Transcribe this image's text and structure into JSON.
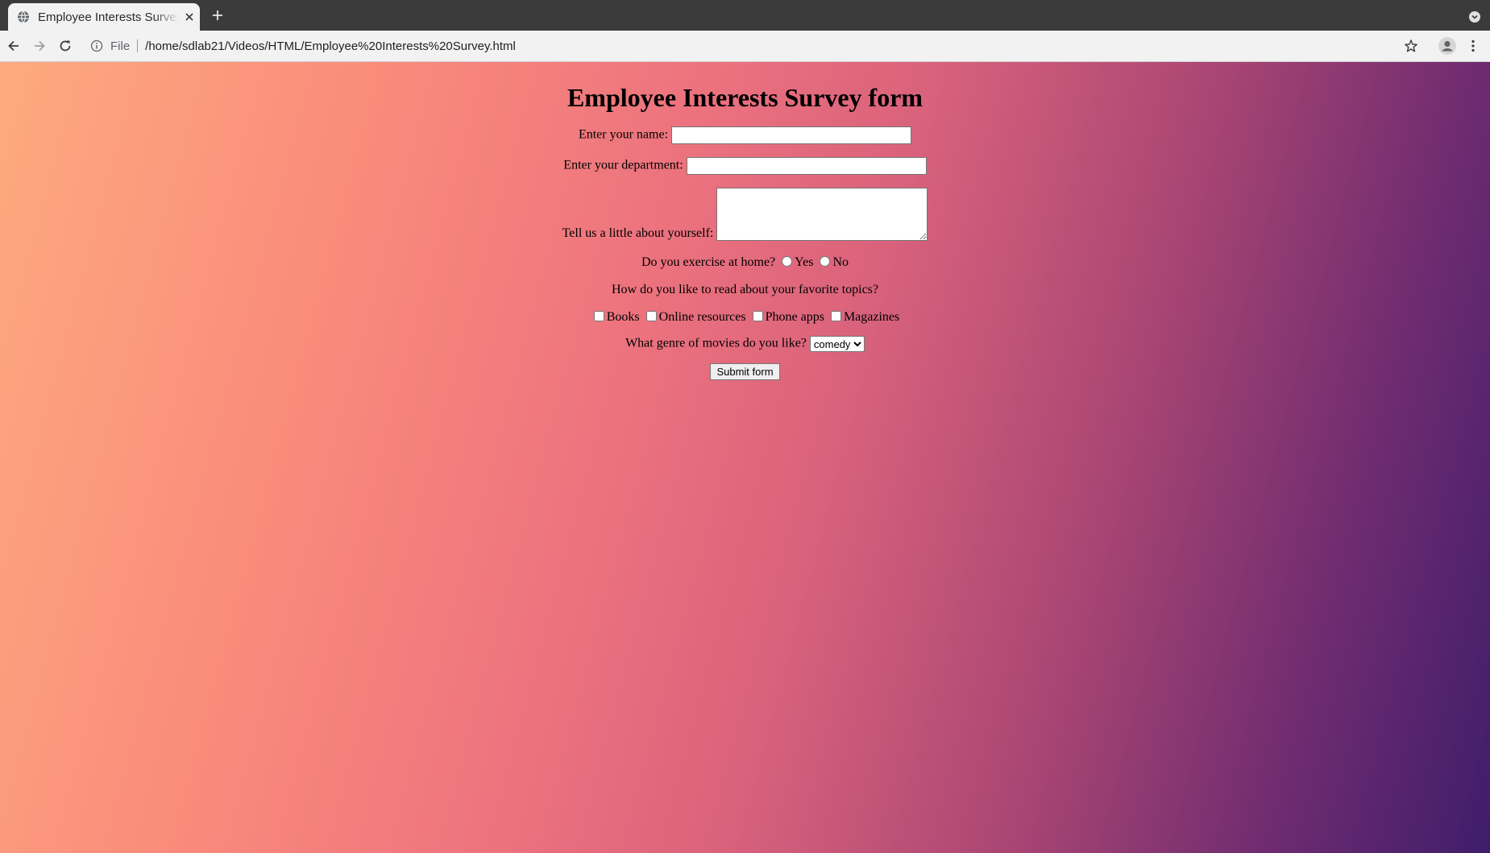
{
  "browser": {
    "tab_title": "Employee Interests Survey form",
    "scheme_label": "File",
    "url": "/home/sdlab21/Videos/HTML/Employee%20Interests%20Survey.html"
  },
  "form": {
    "heading": "Employee Interests Survey form",
    "name_label": "Enter your name:",
    "name_value": "",
    "department_label": "Enter your department:",
    "department_value": "",
    "about_label": "Tell us a little about yourself:",
    "about_value": "",
    "exercise_question": "Do you exercise at home?",
    "exercise_options": [
      "Yes",
      "No"
    ],
    "read_question": "How do you like to read about your favorite topics?",
    "read_options": [
      "Books",
      "Online resources",
      "Phone apps",
      "Magazines"
    ],
    "movie_question": "What genre of movies do you like?",
    "movie_selected": "comedy",
    "submit_label": "Submit form"
  },
  "colors": {
    "gradient_start": "#fdaa7f",
    "gradient_mid": "#ec727e",
    "gradient_end": "#3f1d6b"
  }
}
